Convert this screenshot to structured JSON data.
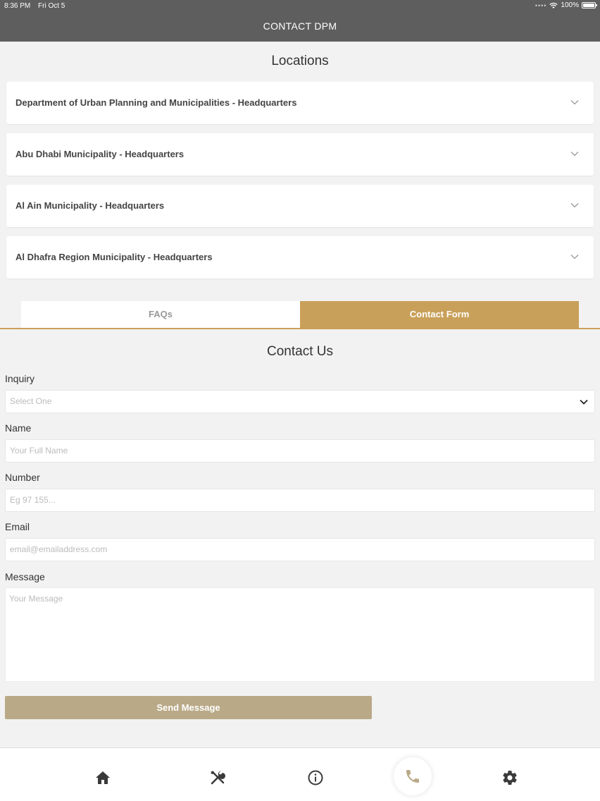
{
  "status_bar": {
    "time": "8:36 PM",
    "date": "Fri Oct 5",
    "battery": "100%"
  },
  "header": {
    "title": "CONTACT DPM"
  },
  "locations": {
    "title": "Locations",
    "items": [
      {
        "label": "Department of Urban Planning and Municipalities - Headquarters"
      },
      {
        "label": "Abu Dhabi Municipality - Headquarters"
      },
      {
        "label": "Al Ain Municipality - Headquarters"
      },
      {
        "label": "Al Dhafra Region Municipality - Headquarters"
      }
    ]
  },
  "tabs": {
    "faqs": "FAQs",
    "contact_form": "Contact Form",
    "active": "Contact Form"
  },
  "form": {
    "title": "Contact Us",
    "inquiry": {
      "label": "Inquiry",
      "value": "Select One"
    },
    "name": {
      "label": "Name",
      "placeholder": "Your Full Name"
    },
    "number": {
      "label": "Number",
      "placeholder": "Eg 97 155..."
    },
    "email": {
      "label": "Email",
      "placeholder": "email@emailaddress.com"
    },
    "message": {
      "label": "Message",
      "placeholder": "Your Message"
    },
    "send_label": "Send Message"
  },
  "bottom_nav": {
    "items": [
      "home-icon",
      "tools-icon",
      "info-icon",
      "phone-icon",
      "settings-icon"
    ],
    "active": "phone-icon"
  },
  "colors": {
    "header": "#5f5e5e",
    "accent": "#c9a05a",
    "button": "#b9a987"
  }
}
